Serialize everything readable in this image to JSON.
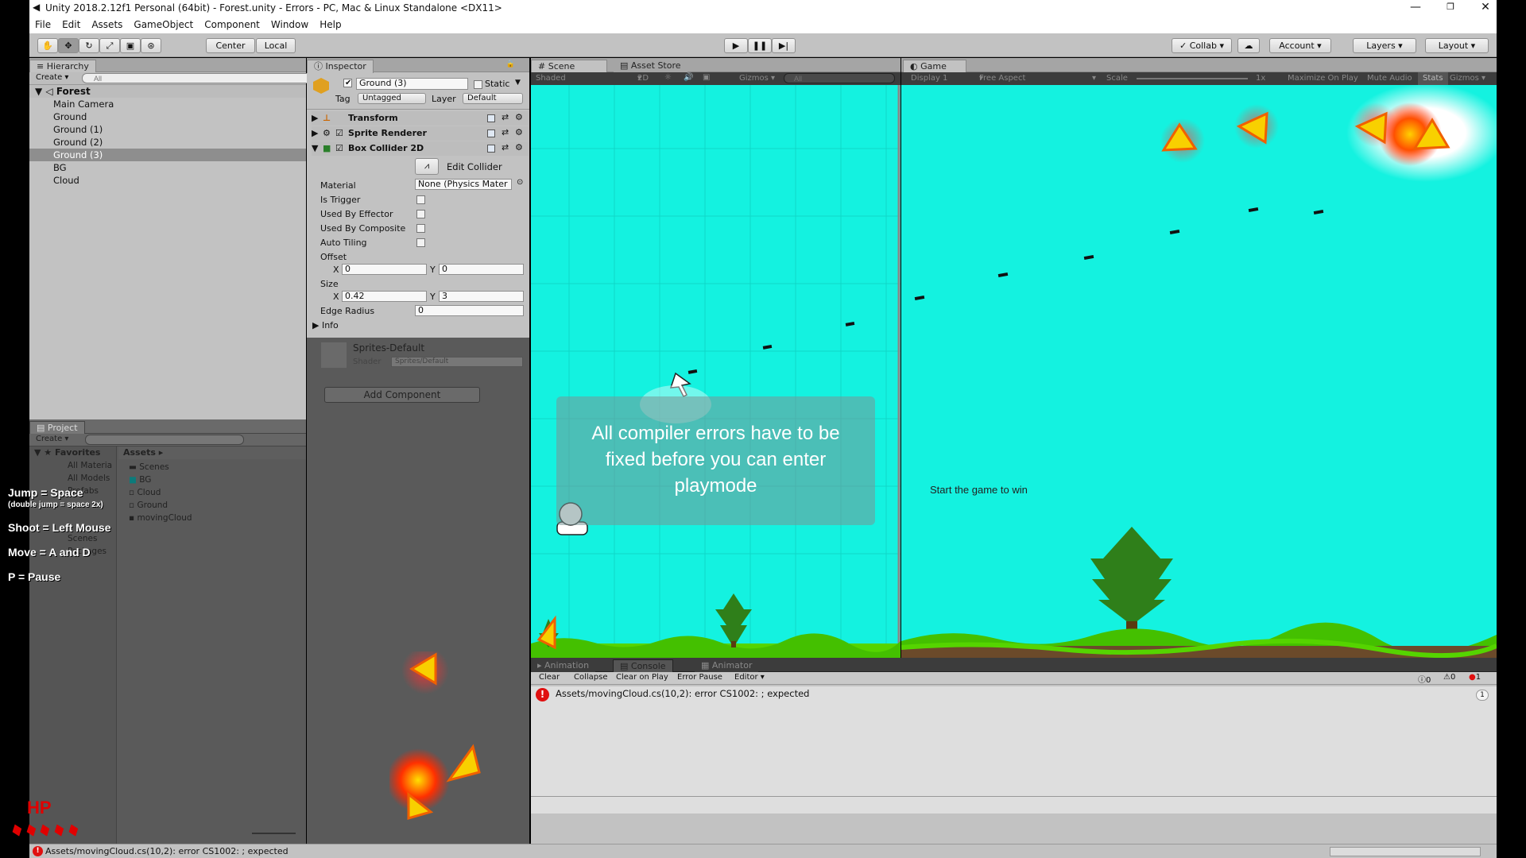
{
  "window": {
    "title": "Unity 2018.2.12f1 Personal (64bit) - Forest.unity - Errors - PC, Mac & Linux Standalone <DX11>",
    "minimize": "—",
    "restore": "❐",
    "close": "✕"
  },
  "menu": [
    "File",
    "Edit",
    "Assets",
    "GameObject",
    "Component",
    "Window",
    "Help"
  ],
  "toolbar": {
    "center": "Center",
    "local": "Local",
    "collab": "Collab",
    "account": "Account",
    "layers": "Layers",
    "layout": "Layout"
  },
  "hierarchy": {
    "tab": "Hierarchy",
    "create": "Create",
    "search_placeholder": "All",
    "scene": "Forest",
    "items": [
      "Main Camera",
      "Ground",
      "Ground (1)",
      "Ground (2)",
      "Ground (3)",
      "BG",
      "Cloud"
    ]
  },
  "inspector": {
    "tab": "Inspector",
    "object_name": "Ground (3)",
    "static": "Static",
    "tag_label": "Tag",
    "tag": "Untagged",
    "layer_label": "Layer",
    "layer": "Default",
    "components": [
      "Transform",
      "Sprite Renderer",
      "Box Collider 2D"
    ],
    "edit_collider": "Edit Collider",
    "props": {
      "material": "Material",
      "material_value": "None (Physics Mater",
      "is_trigger": "Is Trigger",
      "used_by_effector": "Used By Effector",
      "used_by_composite": "Used By Composite",
      "auto_tiling": "Auto Tiling",
      "offset": "Offset",
      "offset_x": "0",
      "offset_y": "0",
      "size": "Size",
      "size_x": "0.42",
      "size_y": "3",
      "edge_radius": "Edge Radius",
      "edge_radius_value": "0",
      "info": "Info",
      "x": "X",
      "y": "Y"
    },
    "material_name": "Sprites-Default",
    "shader_label": "Shader",
    "shader": "Sprites/Default",
    "add_component": "Add Component"
  },
  "project": {
    "tab": "Project",
    "create": "Create",
    "favorites": "Favorites",
    "favorites_items": [
      "All Materia",
      "All Models",
      "Prefabs"
    ],
    "assets_header": "Assets",
    "assets_items": [
      "Scenes",
      "BG",
      "Cloud",
      "Ground",
      "movingCloud"
    ],
    "extra_items": [
      "Scenes"
    ],
    "packages": "Packages"
  },
  "scene": {
    "tab": "Scene",
    "asset_store_tab": "Asset Store",
    "shaded": "Shaded",
    "mode_2d": "2D",
    "gizmos": "Gizmos",
    "search_placeholder": "All",
    "notification": "All compiler errors have to be fixed before you can enter playmode"
  },
  "game": {
    "tab": "Game",
    "display": "Display 1",
    "aspect": "Free Aspect",
    "scale_label": "Scale",
    "scale_value": "1x",
    "maximize": "Maximize On Play",
    "mute": "Mute Audio",
    "stats": "Stats",
    "gizmos": "Gizmos",
    "message": "Start the game to win"
  },
  "console": {
    "tabs": [
      "Animation",
      "Console",
      "Animator"
    ],
    "buttons": [
      "Clear",
      "Collapse",
      "Clear on Play",
      "Error Pause",
      "Editor"
    ],
    "info_count": "0",
    "warning_count": "0",
    "error_count": "1",
    "errors": [
      {
        "text": "Assets/movingCloud.cs(10,2): error CS1002: ; expected",
        "count": "1"
      }
    ]
  },
  "status": {
    "text": "Assets/movingCloud.cs(10,2): error CS1002: ; expected"
  },
  "overlay": {
    "jump": "Jump = Space",
    "jump_sub": "(double jump = space 2x)",
    "shoot": "Shoot = Left Mouse",
    "move": "Move = A and D",
    "pause": "P = Pause",
    "hp": "HP",
    "hp_value": 5
  },
  "colors": {
    "sky": "#14f2e0",
    "grass": "#55d400",
    "panel": "#c2c2c2",
    "dark_panel": "#5a5a5a",
    "error": "#e01010"
  }
}
